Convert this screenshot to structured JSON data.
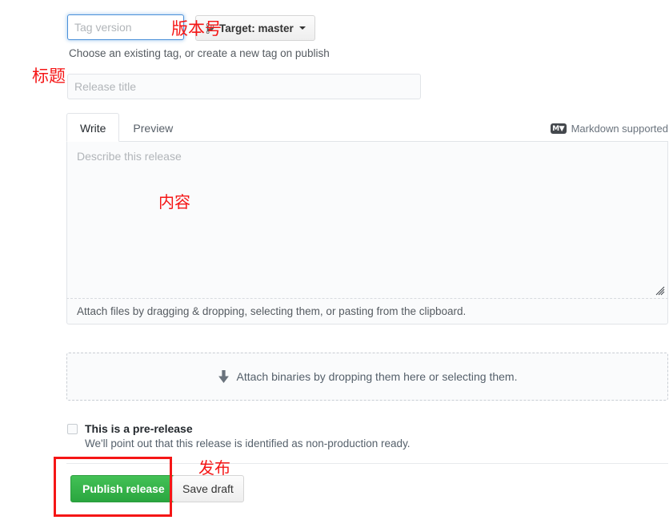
{
  "tag": {
    "placeholder": "Tag version",
    "value": "",
    "help": "Choose an existing tag, or create a new tag on publish",
    "target_label": "Target: master",
    "target_icon": "git-branch-icon"
  },
  "title_field": {
    "placeholder": "Release title",
    "value": ""
  },
  "editor": {
    "tabs": [
      {
        "label": "Write",
        "selected": true
      },
      {
        "label": "Preview",
        "selected": false
      }
    ],
    "markdown_note": "Markdown supported",
    "markdown_badge": "M",
    "describe_placeholder": "Describe this release",
    "describe_value": "",
    "attach_footer": "Attach files by dragging & dropping, selecting them, or pasting from the clipboard."
  },
  "dropzone": {
    "label": "Attach binaries by dropping them here or selecting them.",
    "icon": "download-arrow-icon"
  },
  "prerelease": {
    "label": "This is a pre-release",
    "description": "We'll point out that this release is identified as non-production ready.",
    "checked": false
  },
  "actions": {
    "publish_label": "Publish release",
    "draft_label": "Save draft"
  },
  "annotations": {
    "version": "版本号",
    "title": "标题",
    "content": "内容",
    "publish": "发布",
    "color": "#f51616"
  }
}
